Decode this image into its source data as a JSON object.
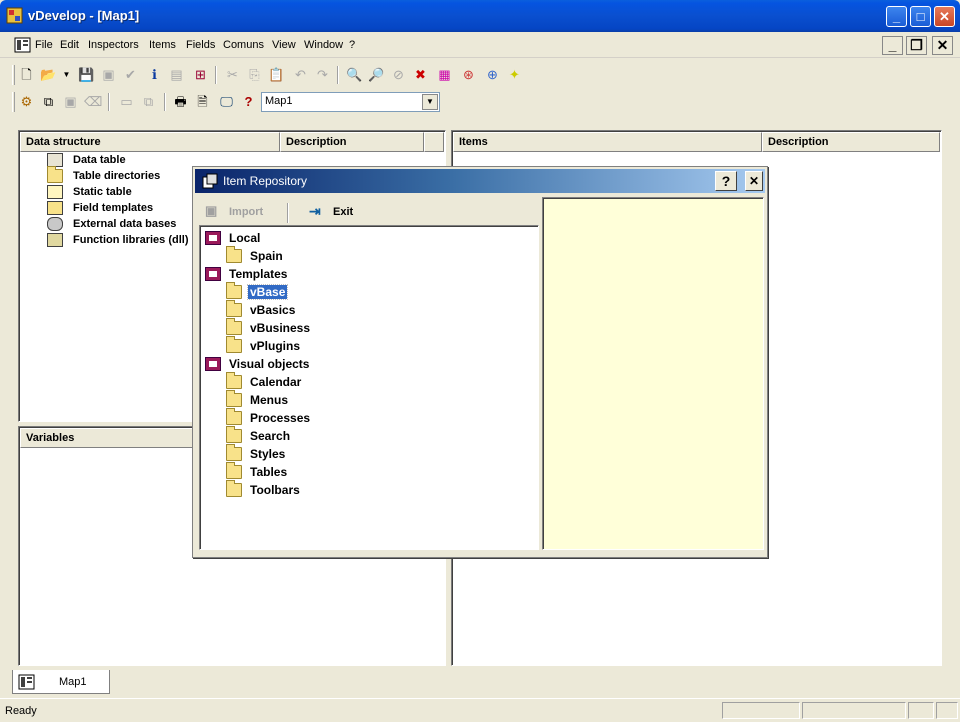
{
  "window": {
    "title": "vDevelop - [Map1]"
  },
  "menu": {
    "items": [
      "File",
      "Edit",
      "Inspectors",
      "Items",
      "Fields",
      "Comuns",
      "View",
      "Window",
      "?"
    ]
  },
  "toolbar": {
    "map_select": "Map1"
  },
  "left_pane": {
    "headers": [
      "Data structure",
      "Description"
    ],
    "tree": [
      "Data table",
      "Table directories",
      "Static table",
      "Field templates",
      "External data bases",
      "Function libraries (dll)"
    ]
  },
  "right_pane": {
    "headers": [
      "Items",
      "Description"
    ]
  },
  "variables_pane": {
    "header": "Variables"
  },
  "dialog": {
    "title": "Item Repository",
    "help_label": "?",
    "close_label": "✕",
    "import_label": "Import",
    "exit_label": "Exit",
    "tree": [
      {
        "label": "Local",
        "level": 0,
        "icon": "cube-icon"
      },
      {
        "label": "Spain",
        "level": 1,
        "icon": "folder-icon"
      },
      {
        "label": "Templates",
        "level": 0,
        "icon": "cube-icon"
      },
      {
        "label": "vBase",
        "level": 1,
        "icon": "folder-icon",
        "selected": true
      },
      {
        "label": "vBasics",
        "level": 1,
        "icon": "folder-icon"
      },
      {
        "label": "vBusiness",
        "level": 1,
        "icon": "folder-icon"
      },
      {
        "label": "vPlugins",
        "level": 1,
        "icon": "folder-icon"
      },
      {
        "label": "Visual objects",
        "level": 0,
        "icon": "cube-icon"
      },
      {
        "label": "Calendar",
        "level": 1,
        "icon": "folder-icon"
      },
      {
        "label": "Menus",
        "level": 1,
        "icon": "folder-icon"
      },
      {
        "label": "Processes",
        "level": 1,
        "icon": "folder-icon"
      },
      {
        "label": "Search",
        "level": 1,
        "icon": "folder-icon"
      },
      {
        "label": "Styles",
        "level": 1,
        "icon": "folder-icon"
      },
      {
        "label": "Tables",
        "level": 1,
        "icon": "folder-icon"
      },
      {
        "label": "Toolbars",
        "level": 1,
        "icon": "folder-icon"
      }
    ]
  },
  "tabs": {
    "map1": "Map1"
  },
  "status": {
    "text": "Ready"
  }
}
